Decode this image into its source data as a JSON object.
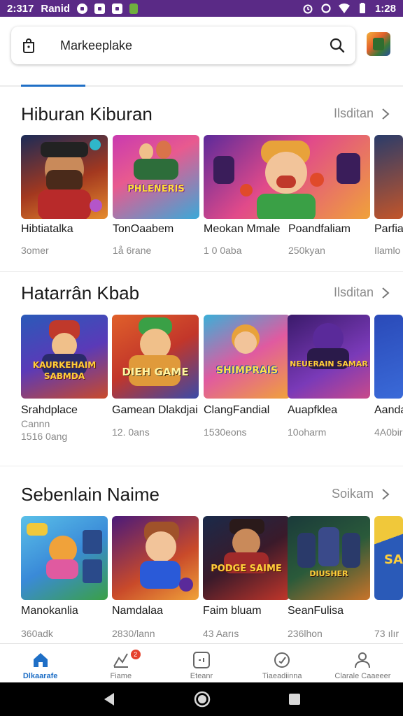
{
  "status_bar": {
    "time_left": "2:317",
    "carrier": "Ranid",
    "time_right": "1:28"
  },
  "search": {
    "label": "Markeeplake"
  },
  "sections": [
    {
      "title": "Hiburan Kiburan",
      "more": "Ilsditan",
      "cards": [
        {
          "name": "Hibtiatalka",
          "sub": "3omer",
          "art": ""
        },
        {
          "name": "TonOaabem",
          "sub": "1å 6rane",
          "art": "PHLENERIS"
        },
        {
          "name": "Meokan Mmale",
          "sub": "1 0 0aba",
          "art": ""
        },
        {
          "name": "Poandfaliam",
          "sub": "250kyan",
          "art": ""
        },
        {
          "name": "Parfia",
          "sub": "Ilamlo",
          "art": ""
        }
      ]
    },
    {
      "title": "Hatarrân Kbab",
      "more": "Ilsditan",
      "cards": [
        {
          "name": "Srahdplace",
          "sub": "Cannn",
          "sub2": "1516 0ang",
          "art": "KAURKEHAIM SABMDA"
        },
        {
          "name": "Gamean Dlakdjai",
          "sub": "12. 0ans",
          "art": "DIEH GAME"
        },
        {
          "name": "ClangFandial",
          "sub": "1530eons",
          "art": "SHIMPRAIS"
        },
        {
          "name": "Auapfklea",
          "sub": "10oharm",
          "art": "NEUERAIN SAMAR"
        },
        {
          "name": "Aanda",
          "sub": "4A0bir",
          "art": ""
        }
      ]
    },
    {
      "title": "Sebenlain Naime",
      "more": "Soikam",
      "cards": [
        {
          "name": "Manokanlia",
          "sub": "360adk",
          "art": ""
        },
        {
          "name": "Namdalaa",
          "sub": "2830/lann",
          "art": ""
        },
        {
          "name": "Faim bluam",
          "sub": "43 Aarıs",
          "art": "PODGE SAIME"
        },
        {
          "name": "SeanFulisa",
          "sub": "236lhon",
          "art": "DIUSHER"
        },
        {
          "name": "",
          "sub": "73 ılır",
          "art": "SA"
        }
      ]
    }
  ],
  "bottom_nav": [
    {
      "label": "Dlkaarafe",
      "icon": "home-icon"
    },
    {
      "label": "Fiame",
      "icon": "chart-icon",
      "badge": "2"
    },
    {
      "label": "Eteanr",
      "icon": "gamepad-icon"
    },
    {
      "label": "Tiaeadiinna",
      "icon": "clock-icon"
    },
    {
      "label": "Clarale Caaeeer",
      "icon": "person-icon"
    }
  ],
  "colors": {
    "accent": "#1f6fc6",
    "status_bar": "#5a2a86",
    "badge": "#e5412d"
  }
}
